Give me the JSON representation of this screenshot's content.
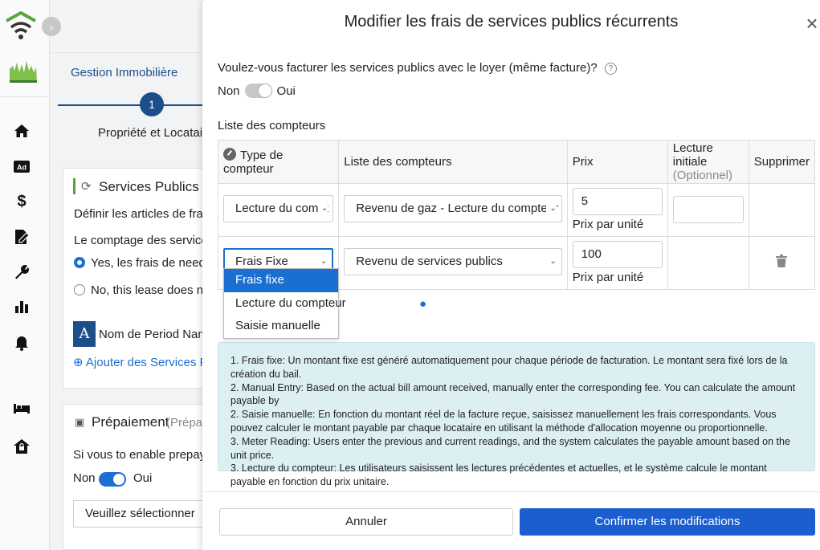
{
  "sidebar": {
    "icons": [
      "wifi-home-logo-icon",
      "collapse-chevron-icon",
      "city-logo-icon",
      "home-icon",
      "ad-icon",
      "dollar-icon",
      "edit-document-icon",
      "wrench-icon",
      "bar-chart-icon",
      "bell-icon",
      "bed-icon",
      "house-lock-icon"
    ],
    "ad_label": "Ad"
  },
  "background": {
    "step_title": "Gestion Immobilière",
    "step_number": "1",
    "step_label": "Propriété et Locataire",
    "utilities_title": "Services Publics Ré",
    "utilities_desc": "Définir les articles de frais",
    "meter_question": "Le comptage des service",
    "radio_yes": "Yes, les frais de need to",
    "radio_no": "No, this lease does not",
    "period_letter": "A",
    "period_name": "Nom de Period Name",
    "add_utilities": "Ajouter des Services Pu",
    "prepaid_title": "Prépaiement",
    "prepaid_sub": "(Prépaie",
    "prepaid_question": "Si vous to enable prepaym",
    "toggle_no": "Non",
    "toggle_yes": "Oui",
    "select_placeholder": "Veuillez sélectionner"
  },
  "modal": {
    "title": "Modifier les frais de services publics récurrents",
    "close": "×",
    "question": "Voulez-vous facturer les services publics avec le loyer (même facture)?",
    "help": "?",
    "toggle_no": "Non",
    "toggle_yes": "Oui",
    "section_title": "Liste des compteurs",
    "table": {
      "headers": {
        "type": "Type de compteur",
        "list": "Liste des compteurs",
        "price": "Prix",
        "initial": "Lecture initiale",
        "initial_sub": "(Optionnel)",
        "delete": "Supprimer"
      },
      "rows": [
        {
          "type": "Lecture du compt",
          "list": "Revenu de gaz - Lecture du compteur",
          "price": "5",
          "unit": "Prix par unité"
        },
        {
          "type": "Frais Fixe",
          "list": "Revenu de services publics",
          "price": "100",
          "unit": "Prix par unité"
        }
      ]
    },
    "dropdown_options": [
      "Frais fixe",
      "Lecture du compteur",
      "Saisie manuelle"
    ],
    "info_lines": [
      "1. Frais fixe: Un montant fixe est généré automatiquement pour chaque période de facturation. Le montant sera fixé lors de la création du bail.",
      "2. Manual Entry: Based on the actual bill amount received, manually enter the corresponding fee. You can calculate the amount payable by",
      "2. Saisie manuelle: En fonction du montant réel de la facture reçue, saisissez manuellement les frais correspondants. Vous pouvez calculer le montant payable par chaque locataire en utilisant la méthode d'allocation moyenne ou proportionnelle.",
      "3. Meter Reading: Users enter the previous and current readings, and the system calculates the payable amount based on the unit price.",
      "3. Lecture du compteur: Les utilisateurs saisissent les lectures précédentes et actuelles, et le système calcule le montant payable en fonction du prix unitaire."
    ],
    "cancel": "Annuler",
    "confirm": "Confirmer les modifications"
  }
}
